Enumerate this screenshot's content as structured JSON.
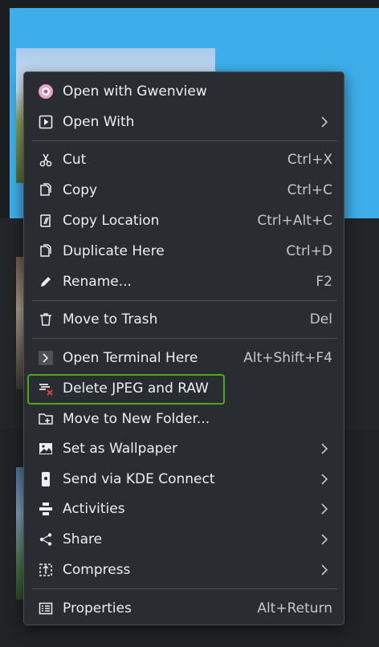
{
  "menu": {
    "items": [
      {
        "label": "Open with Gwenview",
        "icon": "gwenview-icon"
      },
      {
        "label": "Open With",
        "icon": "open-with-icon",
        "submenu": true
      },
      {
        "label": "Cut",
        "shortcut": "Ctrl+X",
        "icon": "cut-icon"
      },
      {
        "label": "Copy",
        "shortcut": "Ctrl+C",
        "icon": "copy-icon"
      },
      {
        "label": "Copy Location",
        "shortcut": "Ctrl+Alt+C",
        "icon": "copy-location-icon"
      },
      {
        "label": "Duplicate Here",
        "shortcut": "Ctrl+D",
        "icon": "duplicate-icon"
      },
      {
        "label": "Rename...",
        "shortcut": "F2",
        "icon": "rename-icon"
      },
      {
        "label": "Move to Trash",
        "shortcut": "Del",
        "icon": "trash-icon"
      },
      {
        "label": "Open Terminal Here",
        "shortcut": "Alt+Shift+F4",
        "icon": "terminal-icon"
      },
      {
        "label": "Delete JPEG and RAW",
        "icon": "delete-jpeg-raw-icon",
        "highlighted": true
      },
      {
        "label": "Move to New Folder...",
        "icon": "new-folder-icon"
      },
      {
        "label": "Set as Wallpaper",
        "icon": "wallpaper-icon",
        "submenu": true
      },
      {
        "label": "Send via KDE Connect",
        "icon": "kde-connect-icon",
        "submenu": true
      },
      {
        "label": "Activities",
        "icon": "activities-icon",
        "submenu": true
      },
      {
        "label": "Share",
        "icon": "share-icon",
        "submenu": true
      },
      {
        "label": "Compress",
        "icon": "compress-icon",
        "submenu": true
      },
      {
        "label": "Properties",
        "shortcut": "Alt+Return",
        "icon": "properties-icon"
      }
    ]
  },
  "colors": {
    "menu_background": "#292c30",
    "selection_background": "#3daee9",
    "highlight_border": "#4ea81c",
    "text": "#eceff1"
  }
}
